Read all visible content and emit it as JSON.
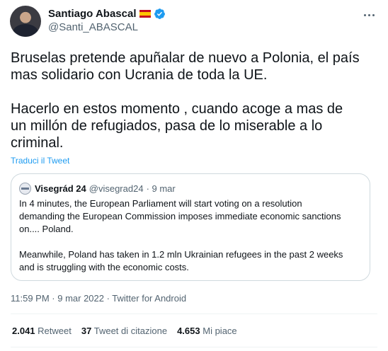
{
  "author": {
    "name": "Santiago Abascal",
    "handle": "@Santi_ABASCAL"
  },
  "tweet": {
    "text": "Bruselas pretende apuñalar de nuevo a Polonia, el país\nmas solidario con Ucrania de toda la UE.\n\nHacerlo en estos momento , cuando acoge a mas de\nun millón de refugiados, pasa de lo miserable a lo\ncriminal.",
    "translate_label": "Traduci il Tweet"
  },
  "quoted": {
    "name": "Visegrád 24",
    "handle": "@visegrad24",
    "date": "· 9 mar",
    "text": "In 4 minutes, the European Parliament will start voting on a resolution\ndemanding the European Commission imposes immediate economic sanctions\non.... Poland.\n\nMeanwhile, Poland has taken in 1.2 mln Ukrainian refugees in the past 2 weeks\nand is struggling with the economic costs."
  },
  "meta": {
    "timestamp": "11:59 PM · 9 mar 2022 · Twitter for Android"
  },
  "stats": {
    "retweets_count": "2.041",
    "retweets_label": "Retweet",
    "quotes_count": "37",
    "quotes_label": "Tweet di citazione",
    "likes_count": "4.653",
    "likes_label": "Mi piace"
  },
  "colors": {
    "accent": "#1d9bf0",
    "secondary_text": "#536471",
    "border": "#cfd9de"
  }
}
